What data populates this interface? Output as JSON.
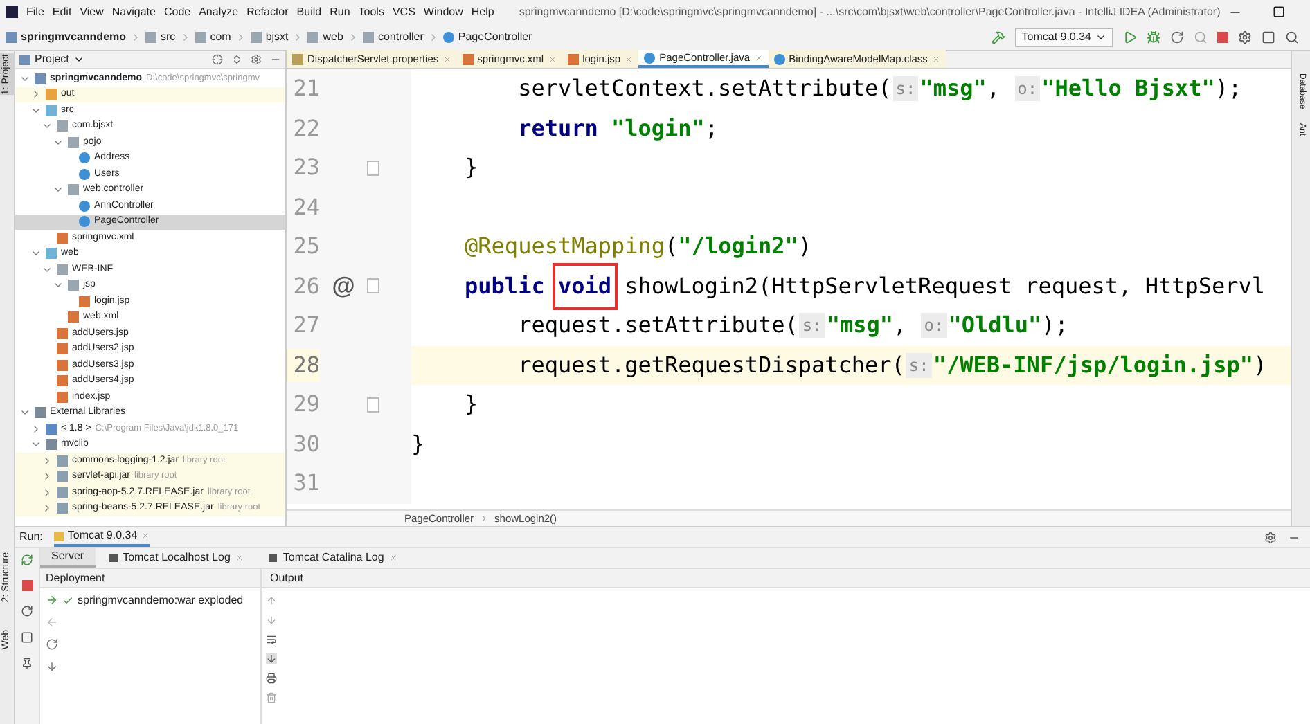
{
  "window": {
    "title": "springmvcanndemo [D:\\code\\springmvc\\springmvcanndemo] - ...\\src\\com\\bjsxt\\web\\controller\\PageController.java - IntelliJ IDEA (Administrator)"
  },
  "menu": [
    "File",
    "Edit",
    "View",
    "Navigate",
    "Code",
    "Analyze",
    "Refactor",
    "Build",
    "Run",
    "Tools",
    "VCS",
    "Window",
    "Help"
  ],
  "breadcrumbs": [
    {
      "label": "springmvcanndemo",
      "kind": "module"
    },
    {
      "label": "src",
      "kind": "folder"
    },
    {
      "label": "com",
      "kind": "folder"
    },
    {
      "label": "bjsxt",
      "kind": "folder"
    },
    {
      "label": "web",
      "kind": "folder"
    },
    {
      "label": "controller",
      "kind": "folder"
    },
    {
      "label": "PageController",
      "kind": "class"
    }
  ],
  "run_config": "Tomcat 9.0.34",
  "left_stripe": [
    "1: Project",
    "2: Structure",
    "Web"
  ],
  "right_stripe": [
    "Database",
    "Ant"
  ],
  "project_panel": {
    "title": "Project",
    "tree": [
      {
        "label": "springmvcanndemo",
        "hint": "D:\\code\\springmvc\\springmv",
        "kind": "module",
        "expanded": true,
        "selected": false,
        "children": [
          {
            "label": "out",
            "kind": "folder-excluded",
            "expanded": false,
            "selected": false
          },
          {
            "label": "src",
            "kind": "folder-source",
            "expanded": true,
            "selected": false,
            "children": [
              {
                "label": "com.bjsxt",
                "kind": "package",
                "expanded": true,
                "selected": false,
                "children": [
                  {
                    "label": "pojo",
                    "kind": "package",
                    "expanded": true,
                    "selected": false,
                    "children": [
                      {
                        "label": "Address",
                        "kind": "class",
                        "selected": false
                      },
                      {
                        "label": "Users",
                        "kind": "class",
                        "selected": false
                      }
                    ]
                  },
                  {
                    "label": "web.controller",
                    "kind": "package",
                    "expanded": true,
                    "selected": false,
                    "children": [
                      {
                        "label": "AnnController",
                        "kind": "class",
                        "selected": false
                      },
                      {
                        "label": "PageController",
                        "kind": "class",
                        "selected": true
                      }
                    ]
                  }
                ]
              },
              {
                "label": "springmvc.xml",
                "kind": "xml",
                "selected": false
              }
            ]
          },
          {
            "label": "web",
            "kind": "folder-source",
            "expanded": true,
            "selected": false,
            "children": [
              {
                "label": "WEB-INF",
                "kind": "folder",
                "expanded": true,
                "selected": false,
                "children": [
                  {
                    "label": "jsp",
                    "kind": "folder",
                    "expanded": true,
                    "selected": false,
                    "children": [
                      {
                        "label": "login.jsp",
                        "kind": "jsp",
                        "selected": false
                      }
                    ]
                  },
                  {
                    "label": "web.xml",
                    "kind": "xml",
                    "selected": false
                  }
                ]
              },
              {
                "label": "addUsers.jsp",
                "kind": "jsp",
                "selected": false
              },
              {
                "label": "addUsers2.jsp",
                "kind": "jsp",
                "selected": false
              },
              {
                "label": "addUsers3.jsp",
                "kind": "jsp",
                "selected": false
              },
              {
                "label": "addUsers4.jsp",
                "kind": "jsp",
                "selected": false
              },
              {
                "label": "index.jsp",
                "kind": "jsp",
                "selected": false
              }
            ]
          }
        ]
      },
      {
        "label": "External Libraries",
        "kind": "libraries",
        "expanded": true,
        "selected": false,
        "children": [
          {
            "label": "< 1.8 >",
            "hint": "C:\\Program Files\\Java\\jdk1.8.0_171",
            "kind": "sdk",
            "expanded": false,
            "selected": false
          },
          {
            "label": "mvclib",
            "kind": "lib",
            "expanded": true,
            "selected": false,
            "children": [
              {
                "label": "commons-logging-1.2.jar",
                "hint": "library root",
                "kind": "jar",
                "expanded": false,
                "selected": false
              },
              {
                "label": "servlet-api.jar",
                "hint": "library root",
                "kind": "jar",
                "expanded": false,
                "selected": false
              },
              {
                "label": "spring-aop-5.2.7.RELEASE.jar",
                "hint": "library root",
                "kind": "jar",
                "expanded": false,
                "selected": false
              },
              {
                "label": "spring-beans-5.2.7.RELEASE.jar",
                "hint": "library root",
                "kind": "jar",
                "expanded": false,
                "selected": false
              }
            ]
          }
        ]
      }
    ]
  },
  "editor_tabs": [
    {
      "label": "DispatcherServlet.properties",
      "kind": "properties",
      "selected": false
    },
    {
      "label": "springmvc.xml",
      "kind": "xml",
      "selected": false
    },
    {
      "label": "login.jsp",
      "kind": "jsp",
      "selected": false
    },
    {
      "label": "PageController.java",
      "kind": "class",
      "selected": true
    },
    {
      "label": "BindingAwareModelMap.class",
      "kind": "class",
      "selected": false
    }
  ],
  "code_lines": [
    {
      "number": "21",
      "current": false,
      "tokens": [
        {
          "kind": "plain",
          "text": "        servletContext.setAttribute("
        },
        {
          "kind": "hint",
          "text": "s:"
        },
        {
          "kind": "str",
          "text": "\"msg\""
        },
        {
          "kind": "plain",
          "text": ", "
        },
        {
          "kind": "hint",
          "text": "o:"
        },
        {
          "kind": "str",
          "text": "\"Hello Bjsxt\""
        },
        {
          "kind": "plain",
          "text": ");"
        }
      ]
    },
    {
      "number": "22",
      "current": false,
      "tokens": [
        {
          "kind": "kw",
          "text": "        return "
        },
        {
          "kind": "str",
          "text": "\"login\""
        },
        {
          "kind": "plain",
          "text": ";"
        }
      ]
    },
    {
      "number": "23",
      "current": false,
      "fold": true,
      "tokens": [
        {
          "kind": "plain",
          "text": "    }"
        }
      ]
    },
    {
      "number": "24",
      "current": false
    },
    {
      "number": "25",
      "current": false,
      "tokens": [
        {
          "kind": "ann",
          "text": "    @RequestMapping"
        },
        {
          "kind": "plain",
          "text": "("
        },
        {
          "kind": "str",
          "text": "\"/login2\""
        },
        {
          "kind": "plain",
          "text": ")"
        }
      ]
    },
    {
      "number": "26",
      "current": false,
      "fold": true,
      "gutter_icon": "@",
      "tokens": [
        {
          "kind": "kw",
          "text": "    public "
        },
        {
          "kind": "kw",
          "text": "void",
          "boxed": true
        },
        {
          "kind": "plain",
          "text": " showLogin2(HttpServletRequest request, HttpServl"
        }
      ]
    },
    {
      "number": "27",
      "current": false,
      "tokens": [
        {
          "kind": "plain",
          "text": "        request.setAttribute("
        },
        {
          "kind": "hint",
          "text": "s:"
        },
        {
          "kind": "str",
          "text": "\"msg\""
        },
        {
          "kind": "plain",
          "text": ", "
        },
        {
          "kind": "hint",
          "text": "o:"
        },
        {
          "kind": "str",
          "text": "\"Oldlu\""
        },
        {
          "kind": "plain",
          "text": ");"
        }
      ]
    },
    {
      "number": "28",
      "current": true,
      "tokens": [
        {
          "kind": "plain",
          "text": "        request.getRequestDispatcher("
        },
        {
          "kind": "hint",
          "text": "s:"
        },
        {
          "kind": "str",
          "text": "\"/WEB-INF/jsp/login.jsp\""
        },
        {
          "kind": "plain",
          "text": ")"
        }
      ]
    },
    {
      "number": "29",
      "current": false,
      "fold": true,
      "tokens": [
        {
          "kind": "plain",
          "text": "    }"
        }
      ]
    },
    {
      "number": "30",
      "current": false,
      "tokens": [
        {
          "kind": "plain",
          "text": "}"
        }
      ]
    },
    {
      "number": "31",
      "current": false
    }
  ],
  "editor_breadcrumbs": [
    "PageController",
    "showLogin2()"
  ],
  "run_panel": {
    "label": "Run:",
    "tab": "Tomcat 9.0.34",
    "tabs": [
      {
        "label": "Server",
        "selected": true,
        "closable": false
      },
      {
        "label": "Tomcat Localhost Log",
        "selected": false,
        "closable": true
      },
      {
        "label": "Tomcat Catalina Log",
        "selected": false,
        "closable": true
      }
    ],
    "deployment_header": "Deployment",
    "output_header": "Output",
    "deployments": [
      {
        "label": "springmvcanndemo:war exploded",
        "deployed": true
      }
    ]
  }
}
